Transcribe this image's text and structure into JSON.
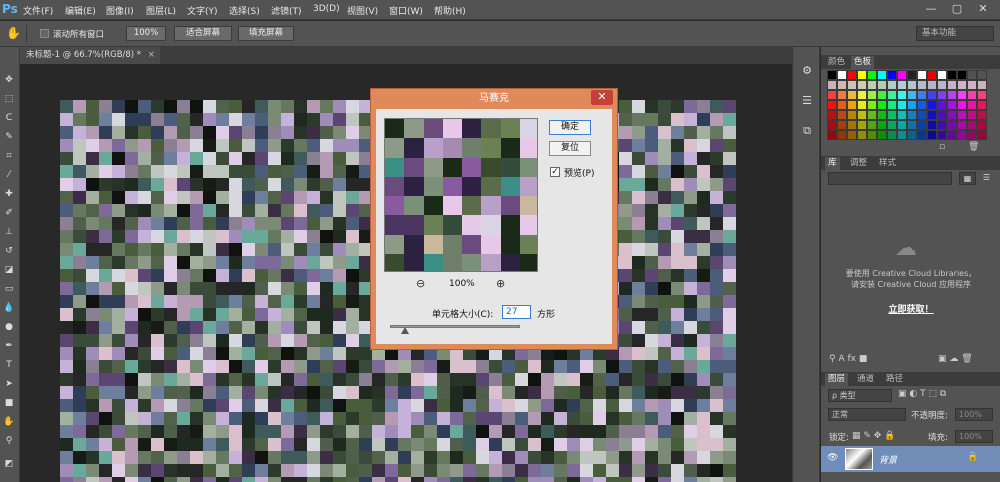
{
  "app": {
    "logo": "Ps"
  },
  "menu": [
    "文件(F)",
    "编辑(E)",
    "图像(I)",
    "图层(L)",
    "文字(Y)",
    "选择(S)",
    "滤镜(T)",
    "3D(D)",
    "视图(V)",
    "窗口(W)",
    "帮助(H)"
  ],
  "window_controls": [
    "—",
    "▢",
    "✕"
  ],
  "options": {
    "scroll_all": "滚动所有窗口",
    "zoom": "100%",
    "fit_screen": "适合屏幕",
    "fill_screen": "填充屏幕",
    "workspace": "基本功能"
  },
  "document": {
    "tab": "未标题-1 @ 66.7%(RGB/8) *"
  },
  "panels": {
    "color_tabs": [
      "颜色",
      "色板"
    ],
    "lib_tabs": [
      "库",
      "调整",
      "样式"
    ],
    "cc_message_line1": "要使用 Creative Cloud Libraries，",
    "cc_message_line2": "请安装 Creative Cloud 应用程序",
    "cc_link": "立即获取！",
    "layer_tabs": [
      "图层",
      "通道",
      "路径"
    ],
    "layer_kind": "ρ 类型",
    "blend_mode": "正常",
    "opacity_label": "不透明度:",
    "opacity_value": "100%",
    "lock_label": "锁定:",
    "fill_label": "填充:",
    "fill_value": "100%",
    "layer_name": "背景"
  },
  "dialog": {
    "title": "马赛克",
    "ok": "确定",
    "reset": "复位",
    "preview_label": "预览(P)",
    "preview_checked": "✓",
    "zoom": "100%",
    "cell_size_label": "单元格大小(C):",
    "cell_size_value": "27",
    "cell_unit": "方形"
  }
}
